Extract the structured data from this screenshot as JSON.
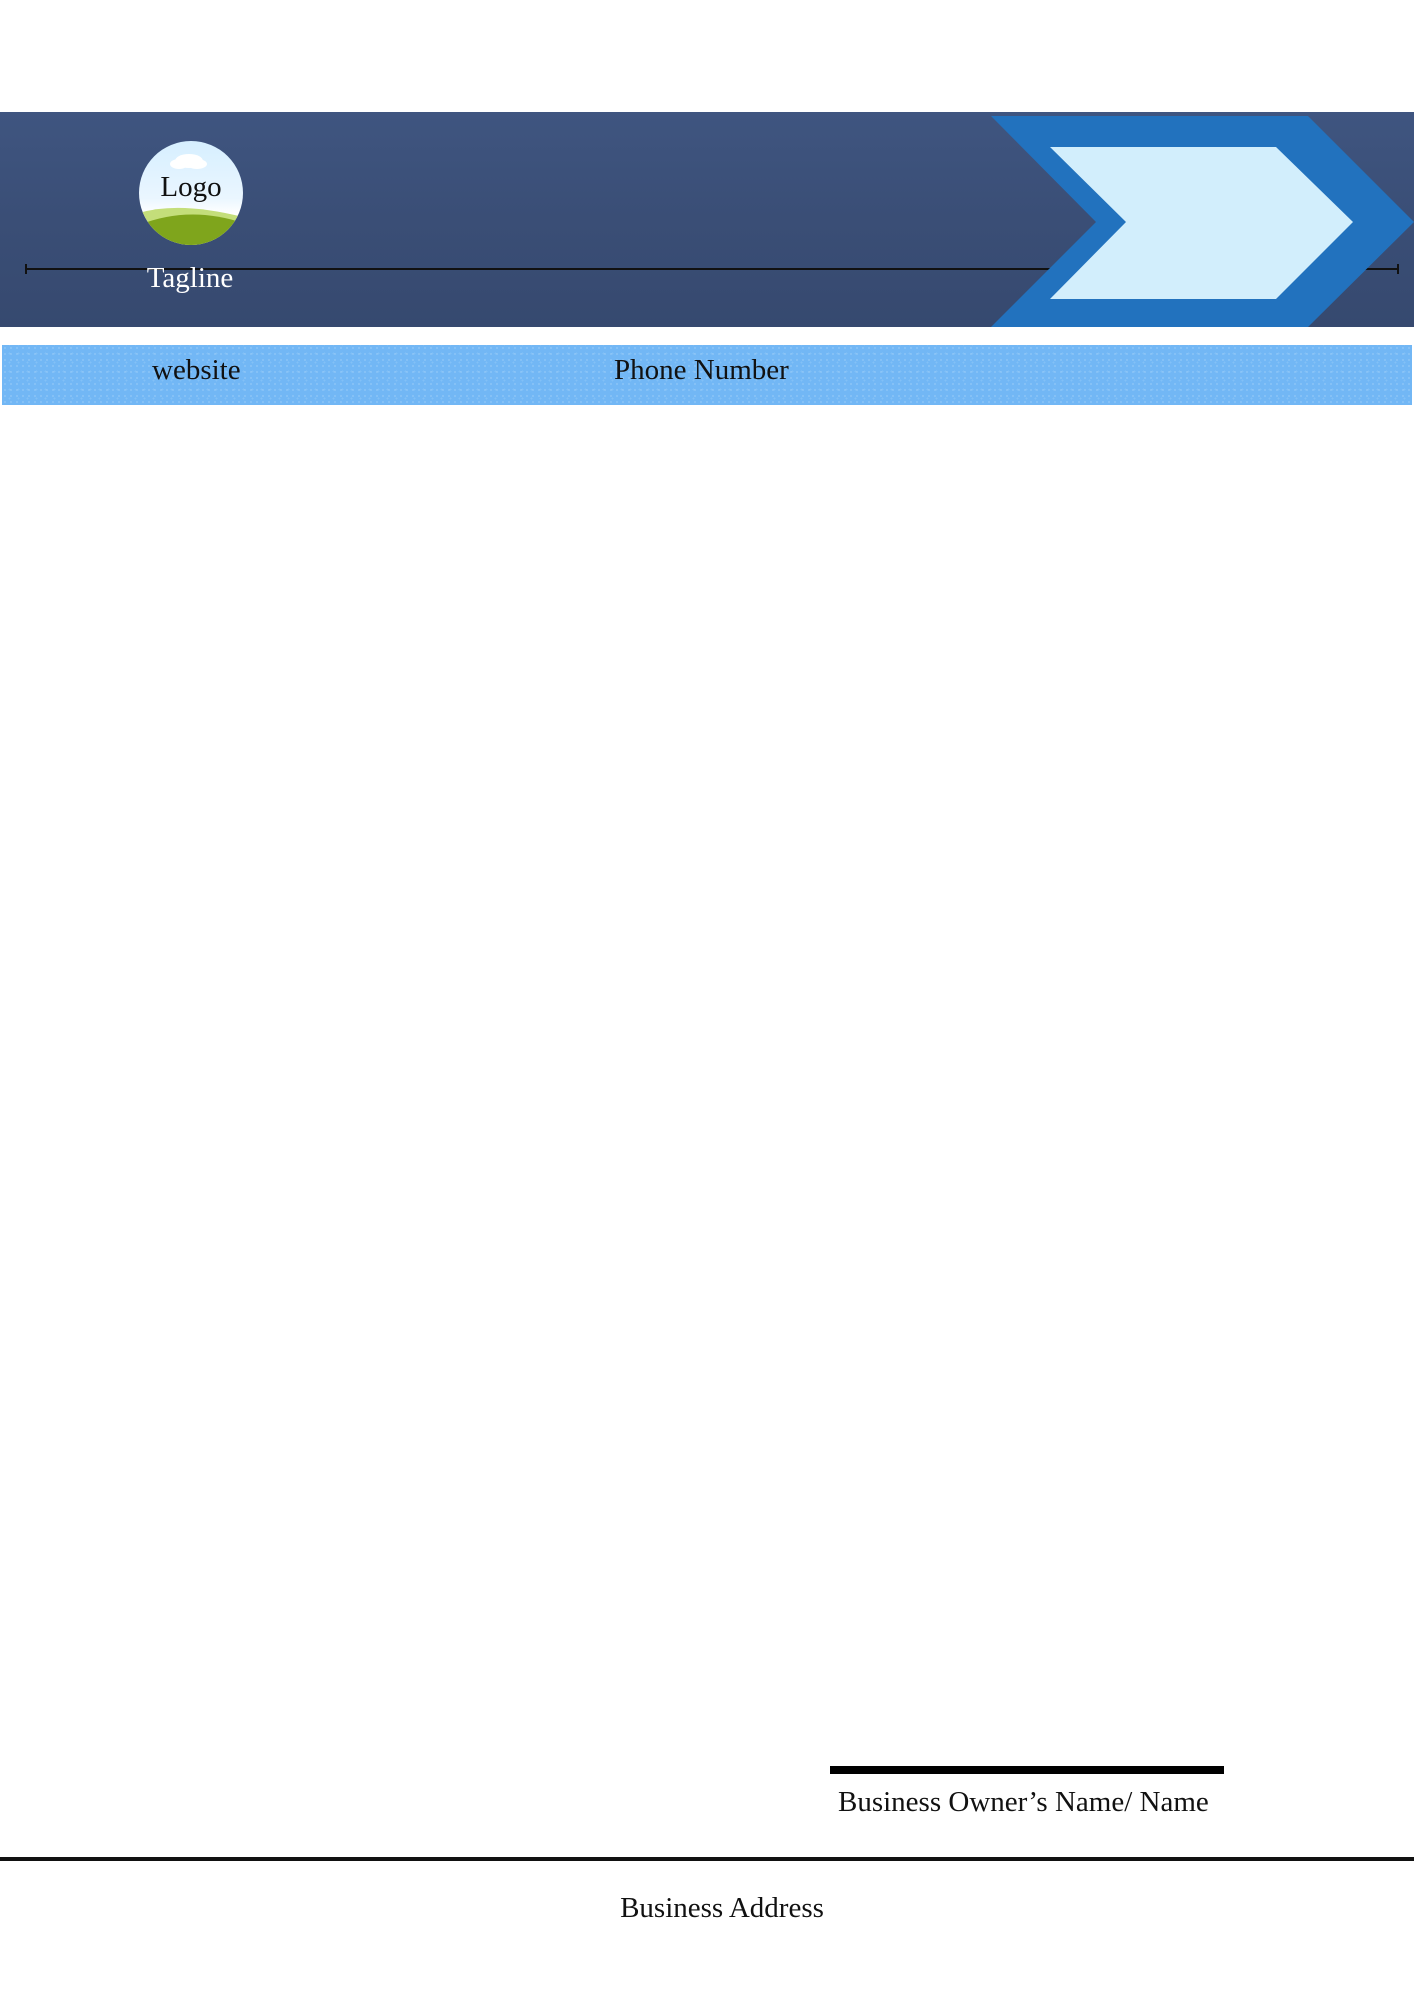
{
  "header": {
    "logo_label": "Logo",
    "tagline": "Tagline"
  },
  "contact_bar": {
    "website": "website",
    "phone": "Phone Number"
  },
  "signature": {
    "owner_name": "Business Owner’s Name/ Name"
  },
  "footer": {
    "address": "Business Address"
  },
  "colors": {
    "header_navy": "#3a4e76",
    "chevron_blue": "#2272be",
    "chevron_light": "#d2eefc",
    "contact_bar_blue": "#72b7f5",
    "logo_grass": "#7fa51c"
  }
}
